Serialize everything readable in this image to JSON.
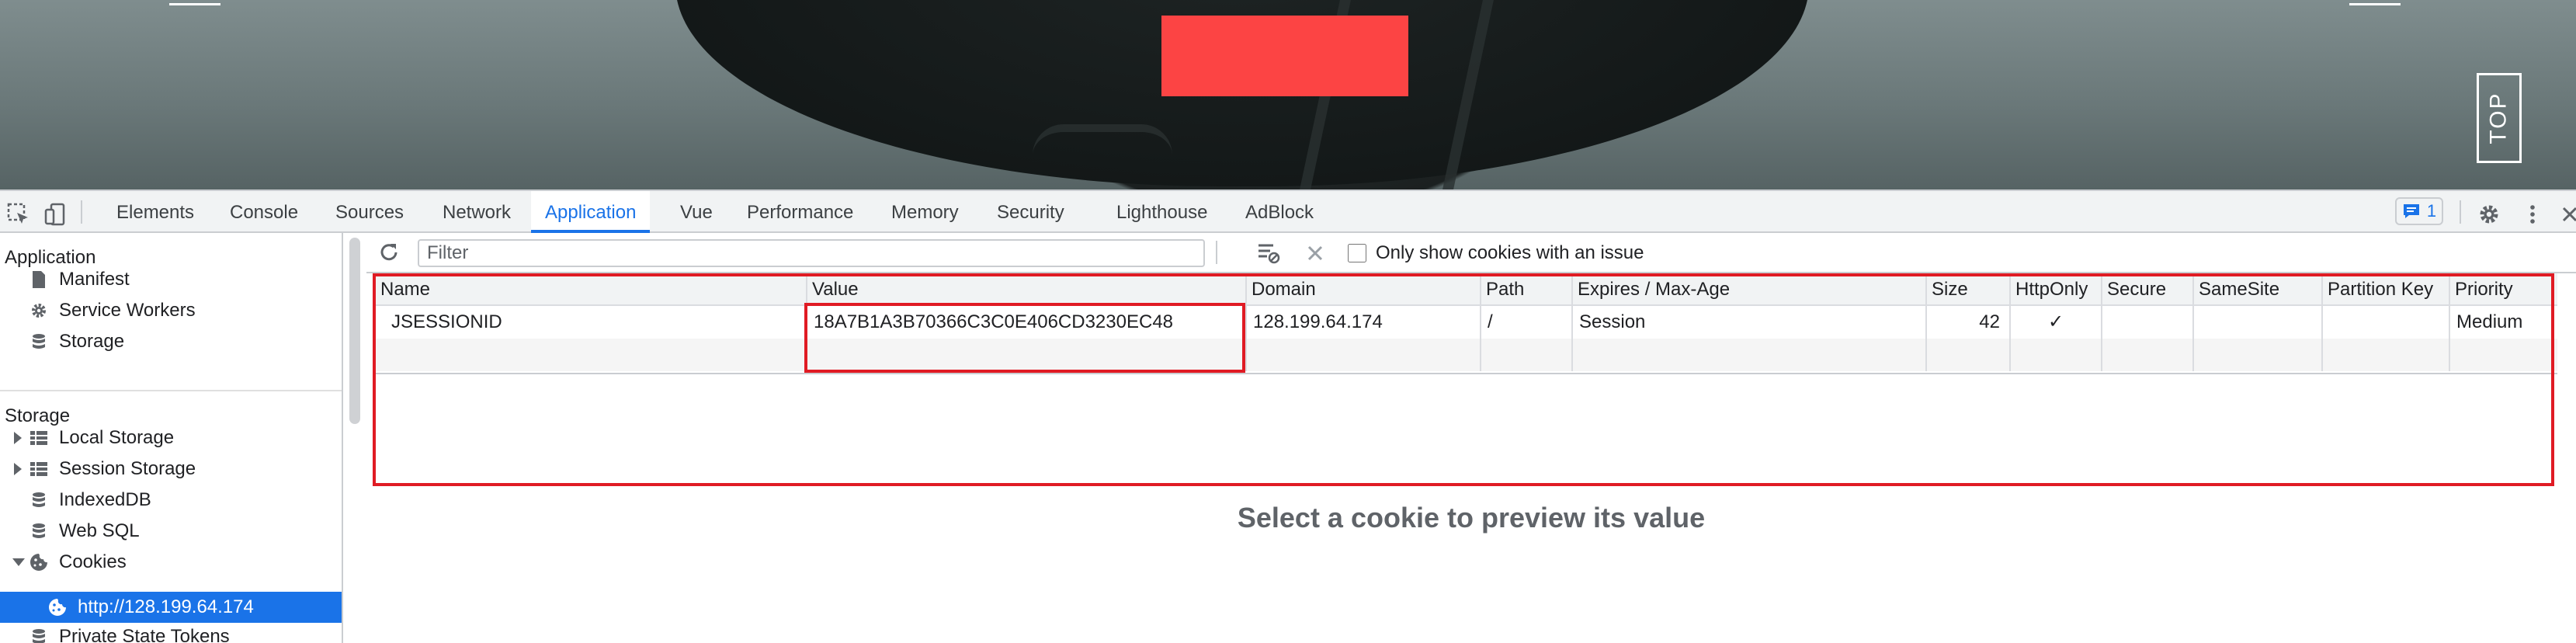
{
  "page": {
    "top_button_label": "TOP",
    "accent_red": "#fc4444"
  },
  "devtools": {
    "tabs": [
      {
        "label": "Elements"
      },
      {
        "label": "Console"
      },
      {
        "label": "Sources"
      },
      {
        "label": "Network"
      },
      {
        "label": "Application",
        "active": true
      },
      {
        "label": "Vue"
      },
      {
        "label": "Performance"
      },
      {
        "label": "Memory"
      },
      {
        "label": "Security"
      },
      {
        "label": "Lighthouse"
      },
      {
        "label": "AdBlock"
      }
    ],
    "issues_count": "1",
    "accent_color": "#1a73e8"
  },
  "sidebar": {
    "application_heading": "Application",
    "application_items": [
      {
        "label": "Manifest",
        "icon": "document-icon"
      },
      {
        "label": "Service Workers",
        "icon": "gear-icon"
      },
      {
        "label": "Storage",
        "icon": "database-icon"
      }
    ],
    "storage_heading": "Storage",
    "storage_items": [
      {
        "label": "Local Storage",
        "icon": "grid-icon"
      },
      {
        "label": "Session Storage",
        "icon": "grid-icon"
      },
      {
        "label": "IndexedDB",
        "icon": "database-icon"
      },
      {
        "label": "Web SQL",
        "icon": "database-icon"
      },
      {
        "label": "Cookies",
        "icon": "cookie-icon"
      },
      {
        "label": "http://128.199.64.174",
        "icon": "cookie-icon"
      },
      {
        "label": "Private State Tokens",
        "icon": "database-icon"
      }
    ]
  },
  "cookies": {
    "filter_placeholder": "Filter",
    "only_issue_label": "Only show cookies with an issue",
    "columns": [
      "Name",
      "Value",
      "Domain",
      "Path",
      "Expires / Max-Age",
      "Size",
      "HttpOnly",
      "Secure",
      "SameSite",
      "Partition Key",
      "Priority"
    ],
    "rows": [
      {
        "name": "JSESSIONID",
        "value": "18A7B1A3B70366C3C0E406CD3230EC48",
        "domain": "128.199.64.174",
        "path": "/",
        "expires": "Session",
        "size": "42",
        "httponly": "✓",
        "secure": "",
        "samesite": "",
        "partition_key": "",
        "priority": "Medium"
      }
    ],
    "preview_message": "Select a cookie to preview its value"
  },
  "annotation_color": "#e01b24"
}
